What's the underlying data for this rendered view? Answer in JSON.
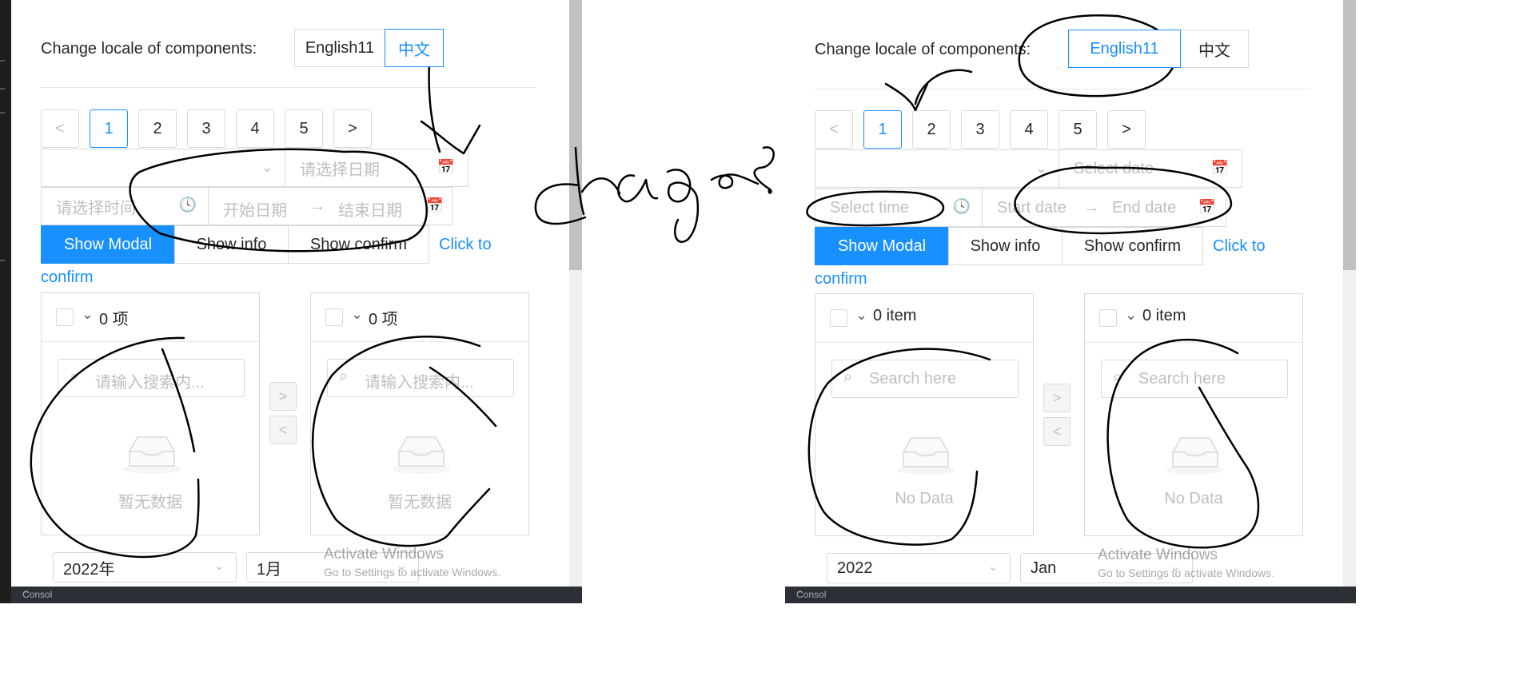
{
  "left_panel": {
    "locale_label": "Change locale of components:",
    "locale_options": [
      "English11",
      "中文"
    ],
    "active_locale": "中文",
    "pagination": {
      "prev": "<",
      "next": ">",
      "pages": [
        "1",
        "2",
        "3",
        "4",
        "5"
      ],
      "current": "1"
    },
    "select_placeholder": "",
    "date_placeholder": "请选择日期",
    "time_placeholder": "请选择时间",
    "range_start": "开始日期",
    "range_sep": "→",
    "range_end": "结束日期",
    "buttons": {
      "modal": "Show Modal",
      "info": "Show info",
      "confirm": "Show confirm"
    },
    "link": {
      "line1": "Click to",
      "line2": "confirm"
    },
    "transfer": {
      "left": {
        "count": "0 项",
        "search": "请输入搜索内...",
        "empty": "暂无数据"
      },
      "right": {
        "count": "0 项",
        "search": "请输入搜索内...",
        "empty": "暂无数据"
      },
      "to_right": ">",
      "to_left": "<"
    },
    "year": "2022年",
    "month": "1月",
    "watermark_title": "Activate Windows",
    "watermark_sub": "Go to Settings to activate Windows."
  },
  "right_panel": {
    "locale_label": "Change locale of components:",
    "locale_options": [
      "English11",
      "中文"
    ],
    "active_locale": "English11",
    "pagination": {
      "prev": "<",
      "next": ">",
      "pages": [
        "1",
        "2",
        "3",
        "4",
        "5"
      ],
      "current": "1"
    },
    "select_placeholder": "",
    "date_placeholder": "Select date",
    "time_placeholder": "Select time",
    "range_start": "Start date",
    "range_sep": "→",
    "range_end": "End date",
    "buttons": {
      "modal": "Show Modal",
      "info": "Show info",
      "confirm": "Show confirm"
    },
    "link": {
      "line1": "Click to",
      "line2": "confirm"
    },
    "transfer": {
      "left": {
        "count": "0 item",
        "search": "Search here",
        "empty": "No Data"
      },
      "right": {
        "count": "0 item",
        "search": "Search here",
        "empty": "No Data"
      },
      "to_right": ">",
      "to_left": "<"
    },
    "year": "2022",
    "month": "Jan",
    "watermark_title": "Activate Windows",
    "watermark_sub": "Go to Settings to activate Windows."
  },
  "handwriting": "changes",
  "colors": {
    "primary": "#1890ff",
    "border": "#d9d9d9",
    "placeholder": "#bfbfbf",
    "ink": "#000000"
  },
  "icons": {
    "calendar": "calendar-icon",
    "clock": "clock-icon",
    "search": "search-icon",
    "inbox": "inbox-icon",
    "chevron": "chevron-down-icon"
  }
}
